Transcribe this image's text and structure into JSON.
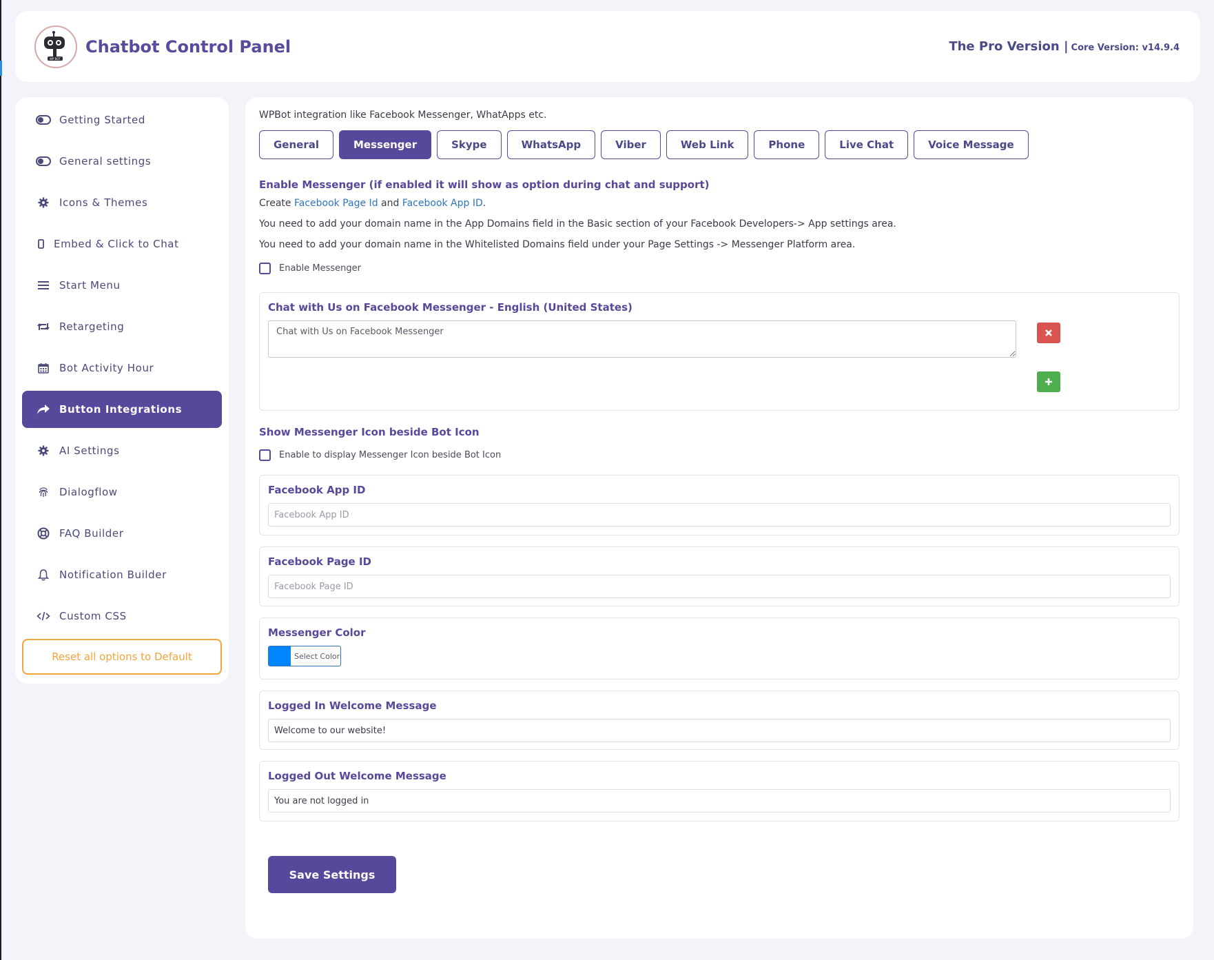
{
  "header": {
    "title": "Chatbot Control Panel",
    "pro_version": "The Pro Version |",
    "core_version": "Core Version: v14.9.4",
    "logo_text": "WP BOT"
  },
  "sidebar": {
    "items": [
      {
        "label": "Getting Started",
        "icon": "toggle-icon"
      },
      {
        "label": "General settings",
        "icon": "toggle-icon"
      },
      {
        "label": "Icons & Themes",
        "icon": "gear-icon"
      },
      {
        "label": "Embed & Click to Chat",
        "icon": "mobile-icon"
      },
      {
        "label": "Start Menu",
        "icon": "menu-icon"
      },
      {
        "label": "Retargeting",
        "icon": "retweet-icon"
      },
      {
        "label": "Bot Activity Hour",
        "icon": "calendar-icon"
      },
      {
        "label": "Button Integrations",
        "icon": "share-icon",
        "active": true
      },
      {
        "label": "AI Settings",
        "icon": "gear-icon"
      },
      {
        "label": "Dialogflow",
        "icon": "fingerprint-icon"
      },
      {
        "label": "FAQ Builder",
        "icon": "lifering-icon"
      },
      {
        "label": "Notification Builder",
        "icon": "bell-icon"
      },
      {
        "label": "Custom CSS",
        "icon": "code-icon"
      }
    ],
    "reset_label": "Reset all options to Default"
  },
  "main": {
    "intro": "WPBot integration like Facebook Messenger, WhatApps etc.",
    "tabs": [
      {
        "label": "General"
      },
      {
        "label": "Messenger",
        "active": true
      },
      {
        "label": "Skype"
      },
      {
        "label": "WhatsApp"
      },
      {
        "label": "Viber"
      },
      {
        "label": "Web Link"
      },
      {
        "label": "Phone"
      },
      {
        "label": "Live Chat"
      },
      {
        "label": "Voice Message"
      }
    ],
    "enable_heading": "Enable Messenger (if enabled it will show as option during chat and support)",
    "create_prefix": "Create",
    "create_link1": "Facebook Page Id",
    "create_and": "and",
    "create_link2": "Facebook App ID",
    "create_suffix": ".",
    "note1": "You need to add your domain name in the App Domains field in the Basic section of your Facebook Developers-> App settings area.",
    "note2": "You need to add your domain name in the Whitelisted Domains field under your Page Settings -> Messenger Platform area.",
    "enable_checkbox_label": "Enable Messenger",
    "chat_card_title": "Chat with Us on Facebook Messenger - English (United States)",
    "chat_card_value": "Chat with Us on Facebook Messenger",
    "show_icon_heading": "Show Messenger Icon beside Bot Icon",
    "show_icon_checkbox_label": "Enable to display Messenger Icon beside Bot Icon",
    "app_id_title": "Facebook App ID",
    "app_id_placeholder": "Facebook App ID",
    "page_id_title": "Facebook Page ID",
    "page_id_placeholder": "Facebook Page ID",
    "color_title": "Messenger Color",
    "color_label": "Select Color",
    "color_value": "#0084ff",
    "logged_in_title": "Logged In Welcome Message",
    "logged_in_value": "Welcome to our website!",
    "logged_out_title": "Logged Out Welcome Message",
    "logged_out_value": "You are not logged in",
    "save_label": "Save Settings"
  },
  "colors": {
    "accent": "#58489b",
    "reset": "#f3a43a",
    "remove": "#d9534f",
    "add": "#4cae4c",
    "link": "#2f74c0"
  }
}
